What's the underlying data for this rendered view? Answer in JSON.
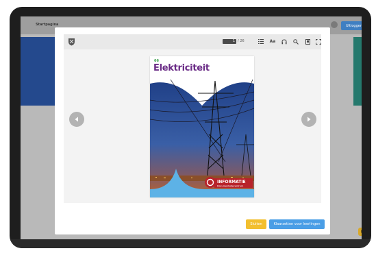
{
  "background": {
    "nav_label": "Startpagina",
    "logout_label": "Uitloggen",
    "helper_emoji": "😊"
  },
  "viewer": {
    "toolbar": {
      "current_page": "1",
      "page_total": "/ 26",
      "text_size_label": "Aa"
    },
    "book": {
      "number": "66",
      "title": "Elektriciteit",
      "badge_title": "INFORMATIE",
      "badge_subtitle": "Documentatiecentrum"
    }
  },
  "footer": {
    "close_label": "Sluiten",
    "ready_label": "Klaarzetten voor leerlingen"
  },
  "colors": {
    "primary_button": "#4a9ee6",
    "secondary_button": "#f2bf2f",
    "title_purple": "#6a2b86"
  }
}
